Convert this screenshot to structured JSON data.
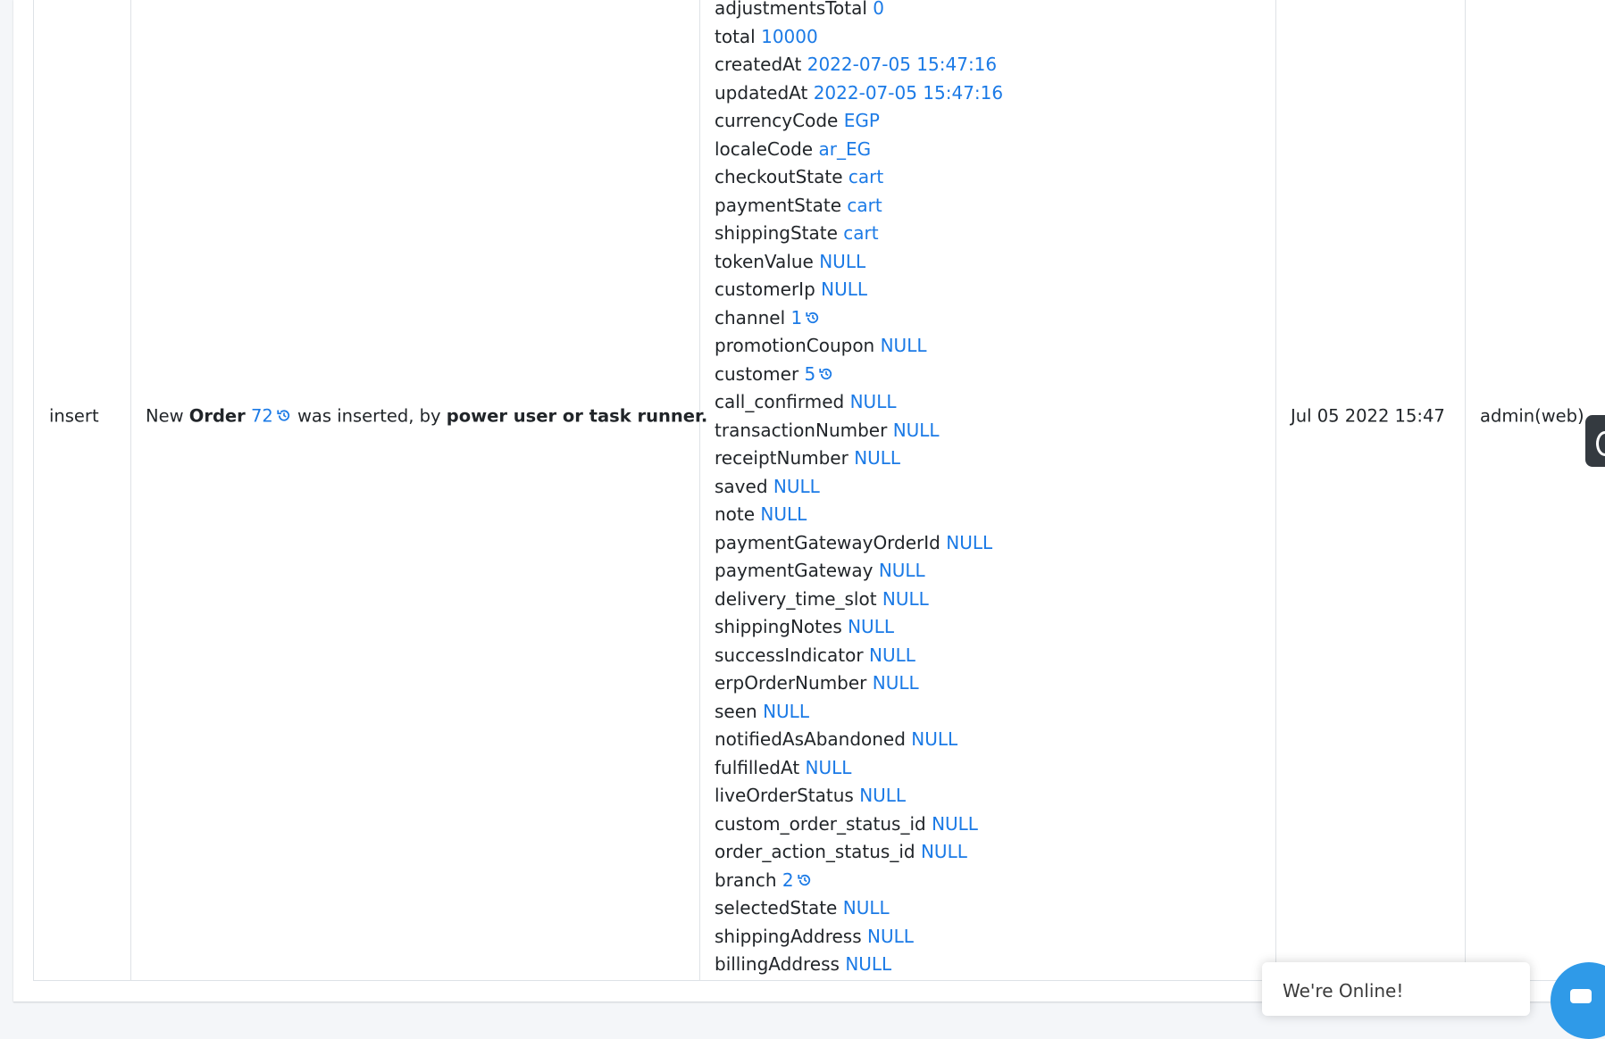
{
  "row": {
    "action": "insert",
    "message": {
      "prefix": "New",
      "entity": "Order",
      "id": "72",
      "middle": "was inserted, by",
      "actor": "power user or task runner."
    },
    "date": "Jul 05 2022 15:47",
    "user": "admin(web)"
  },
  "details": [
    {
      "key": "adjustmentsTotal",
      "value": "0",
      "history": false
    },
    {
      "key": "total",
      "value": "10000",
      "history": false
    },
    {
      "key": "createdAt",
      "value": "2022-07-05 15:47:16",
      "history": false
    },
    {
      "key": "updatedAt",
      "value": "2022-07-05 15:47:16",
      "history": false
    },
    {
      "key": "currencyCode",
      "value": "EGP",
      "history": false
    },
    {
      "key": "localeCode",
      "value": "ar_EG",
      "history": false
    },
    {
      "key": "checkoutState",
      "value": "cart",
      "history": false
    },
    {
      "key": "paymentState",
      "value": "cart",
      "history": false
    },
    {
      "key": "shippingState",
      "value": "cart",
      "history": false
    },
    {
      "key": "tokenValue",
      "value": "NULL",
      "history": false
    },
    {
      "key": "customerIp",
      "value": "NULL",
      "history": false
    },
    {
      "key": "channel",
      "value": "1",
      "history": true
    },
    {
      "key": "promotionCoupon",
      "value": "NULL",
      "history": false
    },
    {
      "key": "customer",
      "value": "5",
      "history": true
    },
    {
      "key": "call_confirmed",
      "value": "NULL",
      "history": false
    },
    {
      "key": "transactionNumber",
      "value": "NULL",
      "history": false
    },
    {
      "key": "receiptNumber",
      "value": "NULL",
      "history": false
    },
    {
      "key": "saved",
      "value": "NULL",
      "history": false
    },
    {
      "key": "note",
      "value": "NULL",
      "history": false
    },
    {
      "key": "paymentGatewayOrderId",
      "value": "NULL",
      "history": false
    },
    {
      "key": "paymentGateway",
      "value": "NULL",
      "history": false
    },
    {
      "key": "delivery_time_slot",
      "value": "NULL",
      "history": false
    },
    {
      "key": "shippingNotes",
      "value": "NULL",
      "history": false
    },
    {
      "key": "successIndicator",
      "value": "NULL",
      "history": false
    },
    {
      "key": "erpOrderNumber",
      "value": "NULL",
      "history": false
    },
    {
      "key": "seen",
      "value": "NULL",
      "history": false
    },
    {
      "key": "notifiedAsAbandoned",
      "value": "NULL",
      "history": false
    },
    {
      "key": "fulfilledAt",
      "value": "NULL",
      "history": false
    },
    {
      "key": "liveOrderStatus",
      "value": "NULL",
      "history": false
    },
    {
      "key": "custom_order_status_id",
      "value": "NULL",
      "history": false
    },
    {
      "key": "order_action_status_id",
      "value": "NULL",
      "history": false
    },
    {
      "key": "branch",
      "value": "2",
      "history": true
    },
    {
      "key": "selectedState",
      "value": "NULL",
      "history": false
    },
    {
      "key": "shippingAddress",
      "value": "NULL",
      "history": false
    },
    {
      "key": "billingAddress",
      "value": "NULL",
      "history": false
    }
  ],
  "chat": {
    "status_text": "We're Online!"
  },
  "colors": {
    "link": "#1b7ae6",
    "text": "#212529",
    "chat_accent": "#2f9ae8"
  },
  "icons": {
    "history": "history-icon",
    "chat": "chat-icon"
  }
}
